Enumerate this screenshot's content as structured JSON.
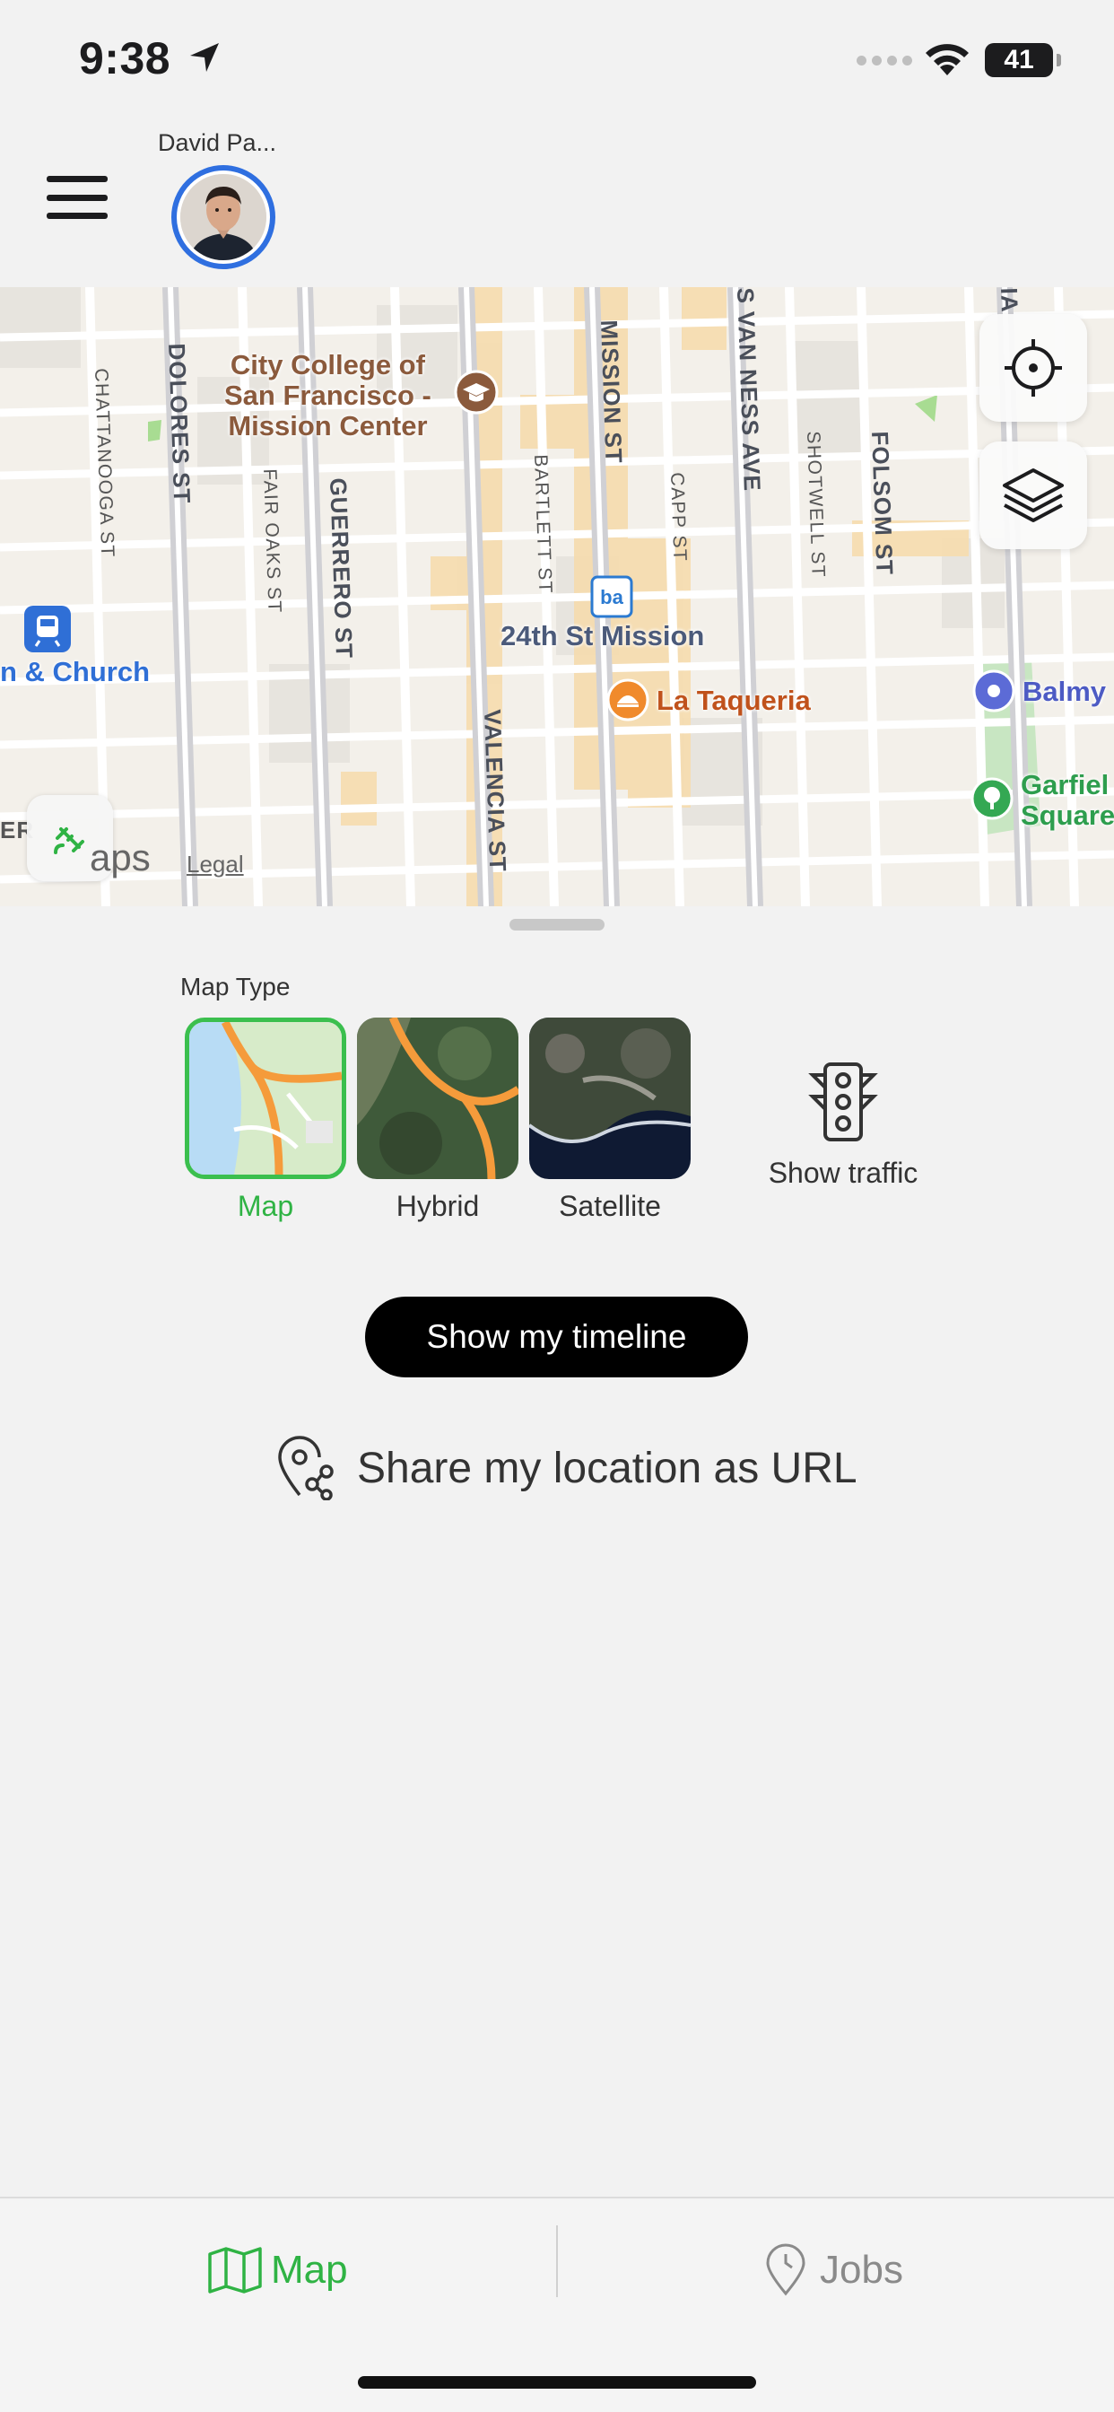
{
  "status_bar": {
    "time": "9:38",
    "battery": "41"
  },
  "header": {
    "user_name": "David Pa..."
  },
  "map": {
    "streets": [
      {
        "name": "CHATTANOOGA ST",
        "style": "small"
      },
      {
        "name": "DOLORES ST",
        "style": "big"
      },
      {
        "name": "FAIR OAKS ST",
        "style": "small"
      },
      {
        "name": "GUERRERO ST",
        "style": "big"
      },
      {
        "name": "BARTLETT ST",
        "style": "small"
      },
      {
        "name": "MISSION ST",
        "style": "big"
      },
      {
        "name": "CAPP ST",
        "style": "small"
      },
      {
        "name": "S VAN NESS AVE",
        "style": "big"
      },
      {
        "name": "SHOTWELL ST",
        "style": "small"
      },
      {
        "name": "FOLSOM ST",
        "style": "big"
      },
      {
        "name": "VALENCIA ST",
        "style": "big"
      },
      {
        "name": "IA",
        "style": "big"
      },
      {
        "name": "ER",
        "style": "big"
      }
    ],
    "pois": {
      "city_college": "City College of\nSan Francisco -\nMission Center",
      "station_24th": "24th St Mission",
      "church": "n & Church",
      "la_taqueria": "La Taqueria",
      "balmy": "Balmy",
      "garfield": "Garfiel\nSquare"
    },
    "brand": "aps",
    "legal": "Legal",
    "colors": {
      "poi_brown": "#8b5a3c",
      "poi_blue": "#2f6fd6",
      "poi_orange": "#c0521c",
      "poi_purple": "#4d5bc4",
      "poi_green": "#2e9e4e"
    }
  },
  "sheet": {
    "map_type_title": "Map Type",
    "map_types": [
      {
        "label": "Map",
        "selected": true
      },
      {
        "label": "Hybrid",
        "selected": false
      },
      {
        "label": "Satellite",
        "selected": false
      }
    ],
    "traffic_label": "Show traffic",
    "timeline_button": "Show my timeline",
    "share_label": "Share my location as URL"
  },
  "tabs": [
    {
      "label": "Map",
      "active": true,
      "icon": "map-icon"
    },
    {
      "label": "Jobs",
      "active": false,
      "icon": "pin-icon"
    }
  ],
  "colors": {
    "accent_green": "#2fb344",
    "avatar_ring": "#2f6fe0",
    "inactive": "#8a8a8a"
  }
}
